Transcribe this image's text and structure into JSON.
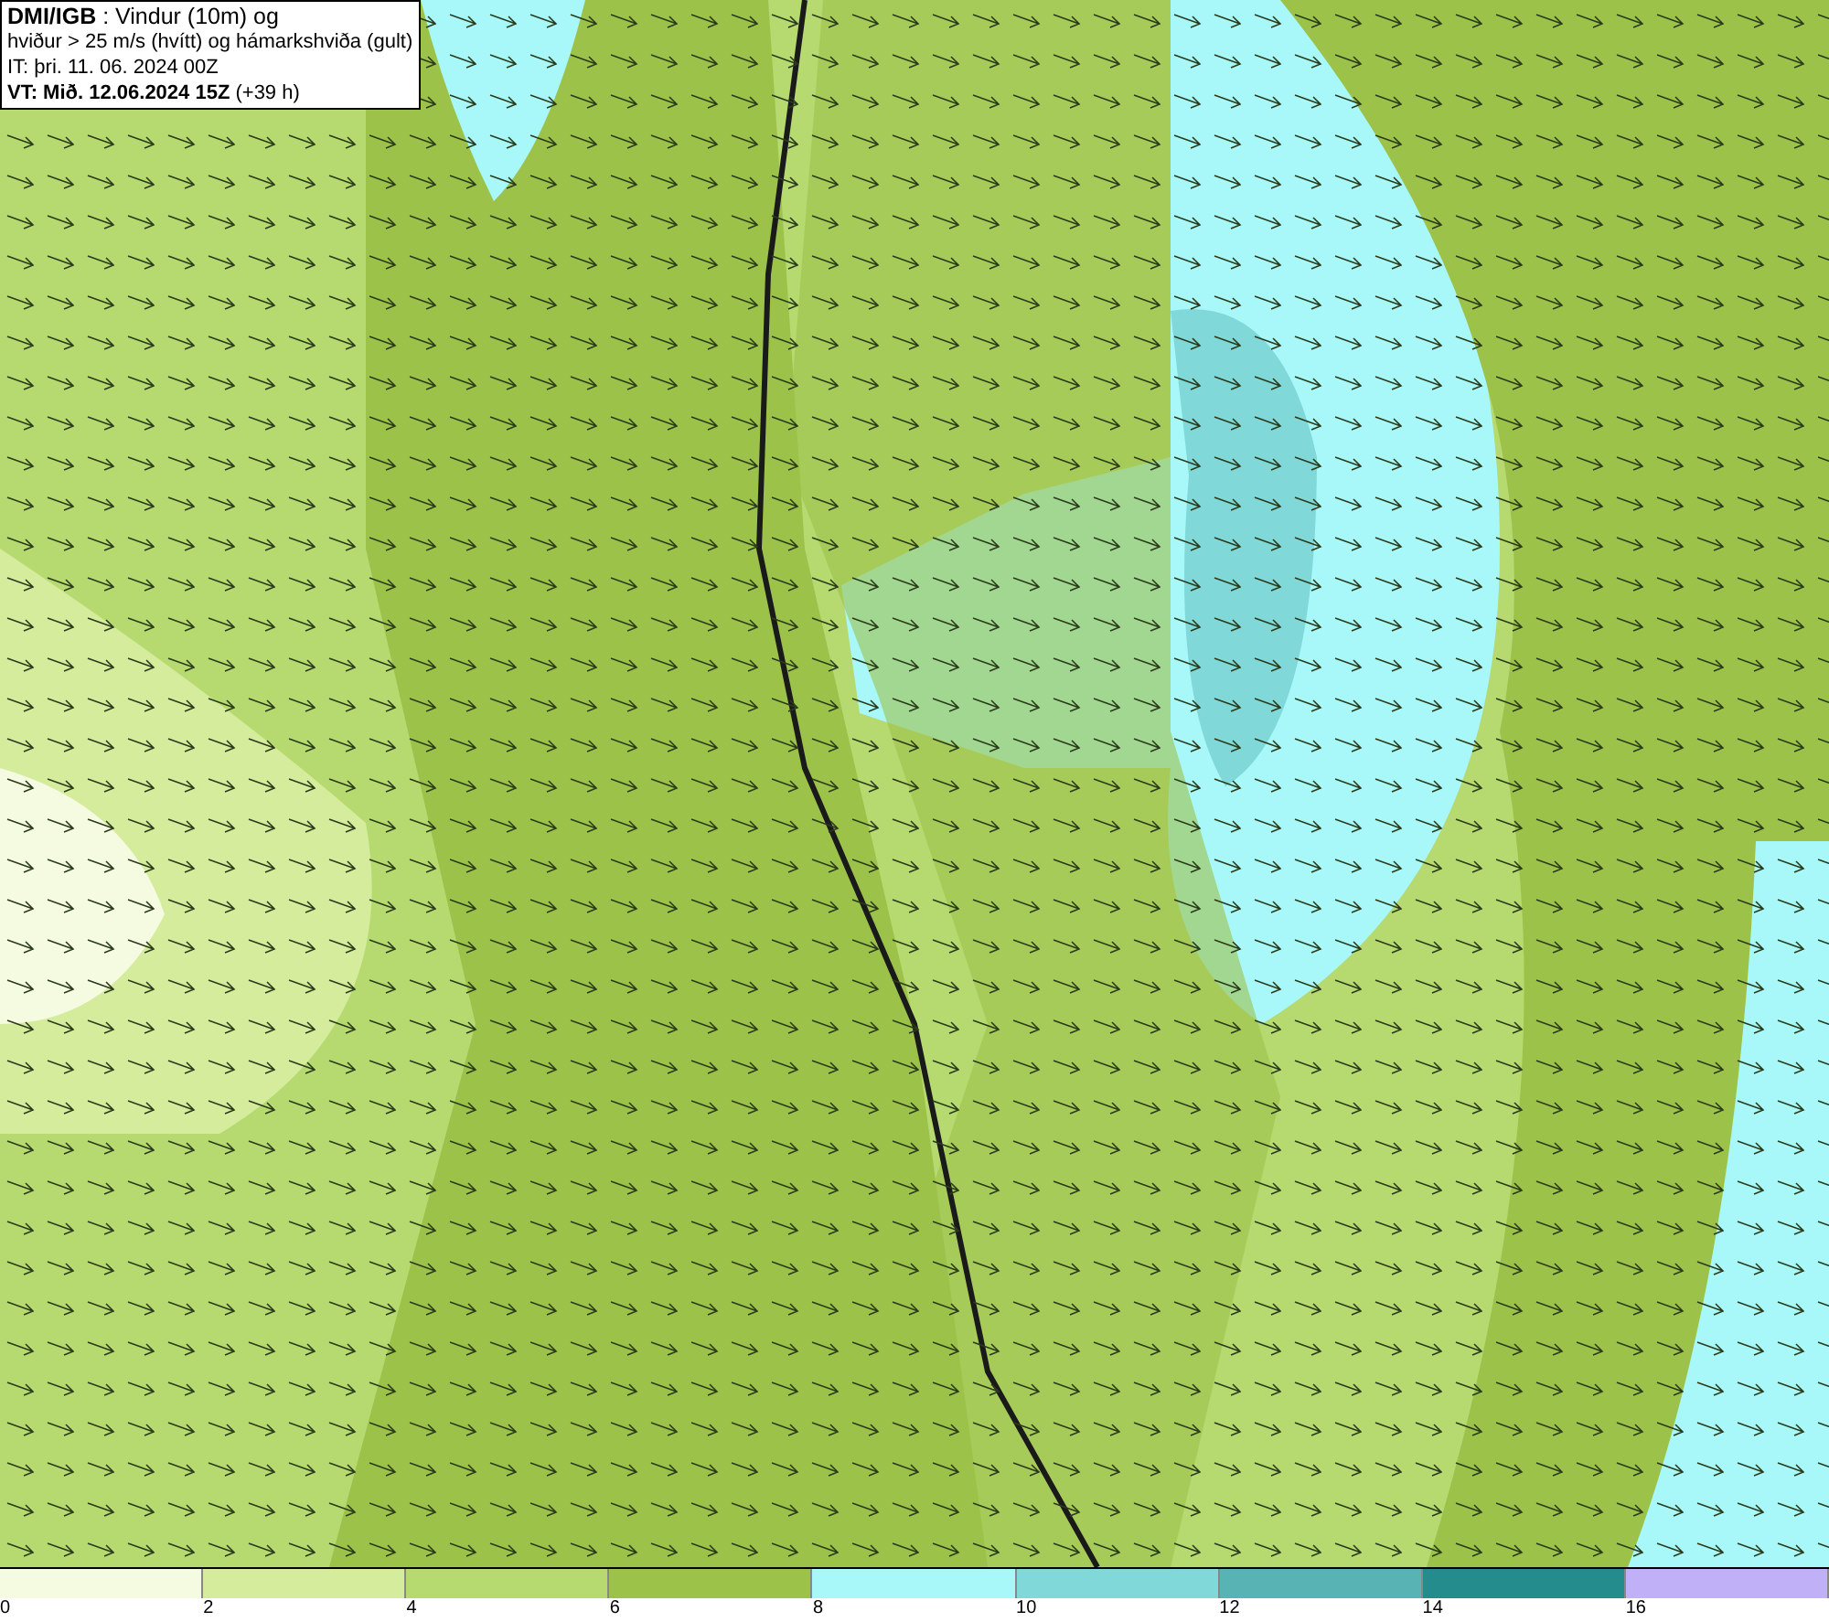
{
  "title_box": {
    "lines": [
      "**DMI/IGB** : Vindur (10m) og",
      "hviður > 25 m/s (hvítt) og hámarkshviða (gult)",
      "IT: þri. 11. 06. 2024 00Z",
      "**VT: Mið. 12.06.2024 15Z** (+39 h)"
    ]
  },
  "legend": {
    "bins": [
      {
        "color": "#f4fbe0",
        "label": "0"
      },
      {
        "color": "#d4ec9c",
        "label": "2"
      },
      {
        "color": "#b6d970",
        "label": "4"
      },
      {
        "color": "#9cc24a",
        "label": "6"
      },
      {
        "color": "#a8f8fa",
        "label": "8"
      },
      {
        "color": "#80d8d8",
        "label": "10"
      },
      {
        "color": "#58b4b4",
        "label": "12"
      },
      {
        "color": "#248c8c",
        "label": "14"
      },
      {
        "color": "#c0b0f8",
        "label": "16"
      }
    ]
  }
}
